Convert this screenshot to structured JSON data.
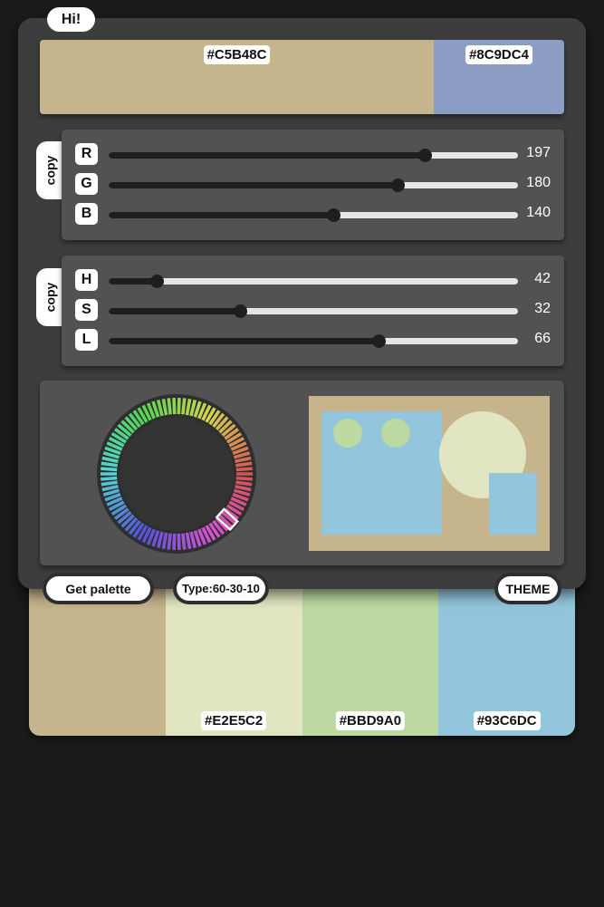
{
  "greeting": "Hi!",
  "colors": {
    "primary": "#C5B48C",
    "secondary": "#8C9DC4"
  },
  "swatch_bar": {
    "primary_hex": "#C5B48C",
    "secondary_hex": "#8C9DC4"
  },
  "rgb": {
    "copy_label": "copy",
    "max": 255,
    "channels": [
      {
        "label": "R",
        "value": 197
      },
      {
        "label": "G",
        "value": 180
      },
      {
        "label": "B",
        "value": 140
      }
    ]
  },
  "hsl": {
    "copy_label": "copy",
    "channels": [
      {
        "label": "H",
        "value": 42,
        "max": 360
      },
      {
        "label": "S",
        "value": 32,
        "max": 100
      },
      {
        "label": "L",
        "value": 66,
        "max": 100
      }
    ]
  },
  "wheel": {
    "selected_hue": 42
  },
  "buttons": {
    "get_palette": "Get palette",
    "type": "Type:60-30-10",
    "theme": "THEME"
  },
  "palette": [
    {
      "color": "#C5B48C",
      "label": ""
    },
    {
      "color": "#E2E5C2",
      "label": "#E2E5C2"
    },
    {
      "color": "#BBD9A0",
      "label": "#BBD9A0"
    },
    {
      "color": "#93C6DC",
      "label": "#93C6DC"
    }
  ]
}
